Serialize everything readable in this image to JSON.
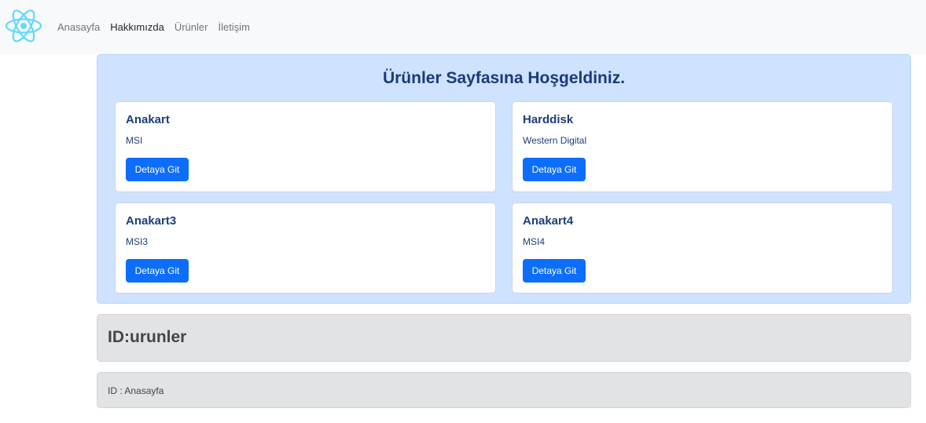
{
  "nav": {
    "logo_icon": "react-atom-icon",
    "links": [
      {
        "label": "Anasayfa",
        "active": false
      },
      {
        "label": "Hakkımızda",
        "active": true
      },
      {
        "label": "Ürünler",
        "active": false
      },
      {
        "label": "İletişim",
        "active": false
      }
    ]
  },
  "products_panel": {
    "title": "Ürünler Sayfasına Hoşgeldiniz.",
    "cards": [
      {
        "title": "Anakart",
        "brand": "MSI",
        "button": "Detaya Git"
      },
      {
        "title": "Harddisk",
        "brand": "Western Digital",
        "button": "Detaya Git"
      },
      {
        "title": "Anakart3",
        "brand": "MSI3",
        "button": "Detaya Git"
      },
      {
        "title": "Anakart4",
        "brand": "MSI4",
        "button": "Detaya Git"
      }
    ]
  },
  "id_panel": {
    "heading": "ID:urunler"
  },
  "id_footer": {
    "text": "ID : Anasayfa"
  },
  "colors": {
    "navbar_bg": "#f8f9fa",
    "primary_alert_bg": "#cfe2ff",
    "button_bg": "#0d6efd",
    "secondary_alert_bg": "#e2e3e5",
    "logo": "#61dafb"
  }
}
